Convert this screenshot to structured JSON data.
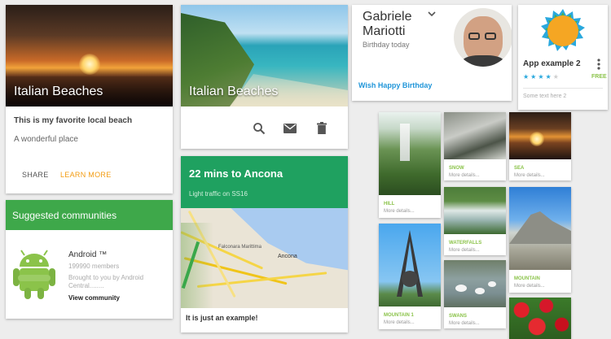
{
  "card_beach_1": {
    "title": "Italian Beaches",
    "heading": "This is my favorite local beach",
    "subtitle": "A wonderful place",
    "share_label": "SHARE",
    "learn_more_label": "LEARN MORE"
  },
  "card_beach_2": {
    "title": "Italian Beaches",
    "actions": [
      "search-icon",
      "mail-icon",
      "delete-icon"
    ]
  },
  "card_communities": {
    "header": "Suggested communities",
    "name": "Android ™",
    "members": "199990 members",
    "byline_1": "Brought to you by Android",
    "byline_2": "Central........",
    "view_label": "View community"
  },
  "card_traffic": {
    "title": "22 mins to Ancona",
    "subtitle": "Light traffic on SS16",
    "footer": "It is just an example!",
    "map_labels": [
      "Falconara Marittima",
      "Ancona"
    ]
  },
  "card_birthday": {
    "first_name": "Gabriele",
    "last_name": "Mariotti",
    "subtitle": "Birthday today",
    "action": "Wish Happy Birthday"
  },
  "card_app": {
    "title": "App example 2",
    "badge": "FREE",
    "rating": 4,
    "rating_max": 5,
    "subtext": "Some text here 2"
  },
  "grid": {
    "items": [
      {
        "label": "HILL",
        "more": "More details..."
      },
      {
        "label": "SNOW",
        "more": "More details..."
      },
      {
        "label": "SEA",
        "more": "More details..."
      },
      {
        "label": "WATERFALLS",
        "more": "More details..."
      },
      {
        "label": "MOUNTAIN",
        "more": "More details..."
      },
      {
        "label": "MOUNTAIN 1",
        "more": "More details..."
      },
      {
        "label": "SWANS",
        "more": "More details..."
      }
    ]
  },
  "colors": {
    "accent_orange": "#f39c12",
    "green": "#3ea84a",
    "traffic_green": "#1fa160",
    "link_blue": "#2196d9",
    "grid_label_green": "#8bc34a"
  }
}
